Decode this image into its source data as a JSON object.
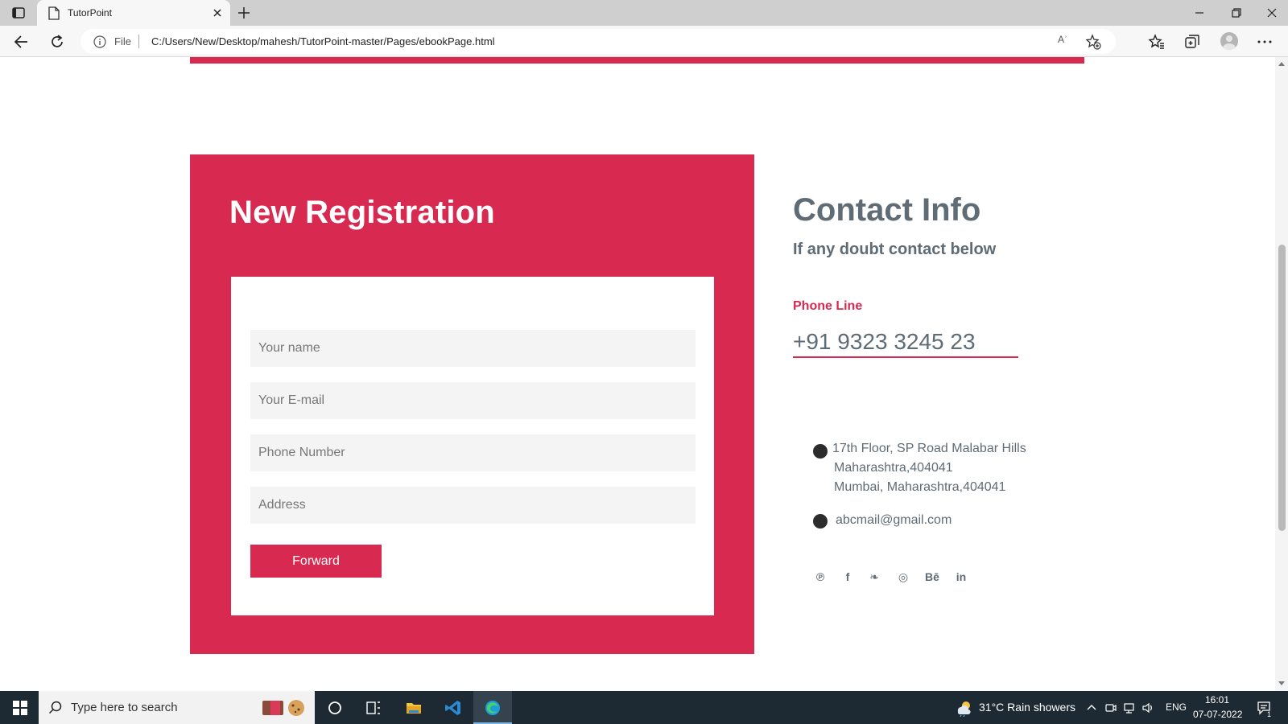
{
  "browser": {
    "tab_title": "TutorPoint",
    "url_scheme": "File",
    "url": "C:/Users/New/Desktop/mahesh/TutorPoint-master/Pages/ebookPage.html",
    "read_aloud_label": "Aʾ"
  },
  "registration": {
    "title": "New Registration",
    "fields": [
      {
        "placeholder": "Your name"
      },
      {
        "placeholder": "Your E-mail"
      },
      {
        "placeholder": "Phone Number"
      },
      {
        "placeholder": "Address"
      }
    ],
    "submit_label": "Forward"
  },
  "contact": {
    "title": "Contact Info",
    "subtitle": "If any doubt contact below",
    "phone_label": "Phone Line",
    "phone_number": "+91 9323 3245 23",
    "address_lines": [
      "17th Floor, SP Road Malabar Hills",
      "Maharashtra,404041",
      "Mumbai, Maharashtra,404041"
    ],
    "email": "abcmail@gmail.com",
    "social": [
      {
        "name": "pinterest",
        "glyph": "℗"
      },
      {
        "name": "facebook",
        "glyph": "f"
      },
      {
        "name": "twitter",
        "glyph": "❧"
      },
      {
        "name": "dribbble",
        "glyph": "◎"
      },
      {
        "name": "behance",
        "glyph": "Bē"
      },
      {
        "name": "linkedin",
        "glyph": "in"
      }
    ]
  },
  "taskbar": {
    "search_placeholder": "Type here to search",
    "weather": "31°C  Rain showers",
    "language": "ENG",
    "time": "16:01",
    "date": "07-07-2022",
    "notification_count": "1"
  },
  "colors": {
    "accent": "#d82a51",
    "text_muted": "#5f6b75",
    "taskbar": "#1d2a33"
  }
}
